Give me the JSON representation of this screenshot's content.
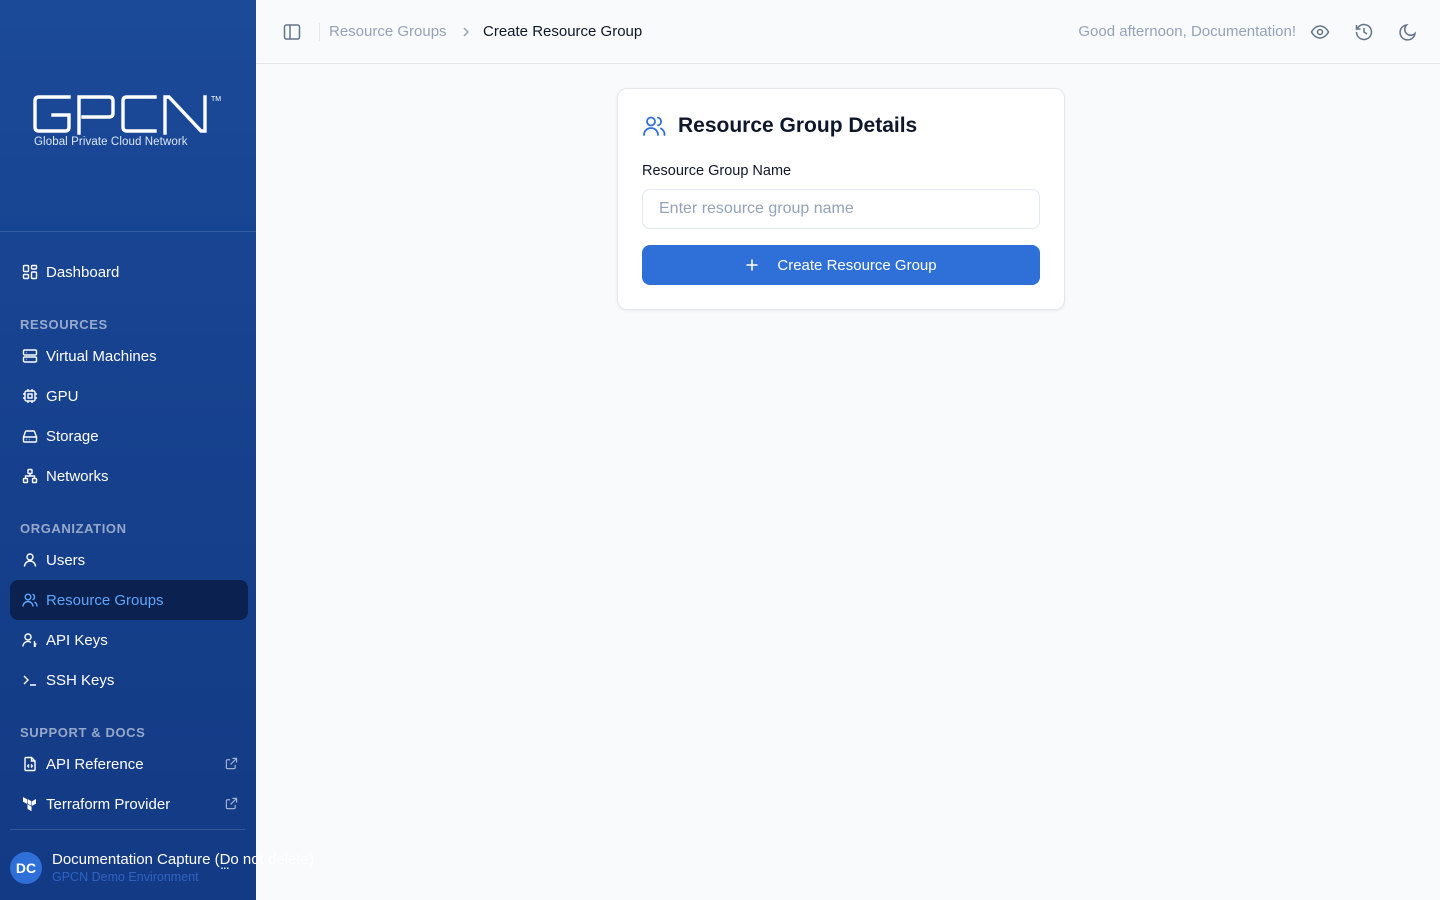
{
  "brand": {
    "logo_text": "GPCN",
    "trademark": "TM",
    "tagline": "Global Private Cloud Network"
  },
  "sidebar": {
    "dashboard": "Dashboard",
    "sections": {
      "resources": "RESOURCES",
      "organization": "ORGANIZATION",
      "support": "SUPPORT & DOCS"
    },
    "resources_items": [
      {
        "label": "Virtual Machines",
        "icon": "server-icon"
      },
      {
        "label": "GPU",
        "icon": "cpu-icon"
      },
      {
        "label": "Storage",
        "icon": "hard-drive-icon"
      },
      {
        "label": "Networks",
        "icon": "network-icon"
      }
    ],
    "organization_items": [
      {
        "label": "Users",
        "icon": "user-icon"
      },
      {
        "label": "Resource Groups",
        "icon": "users-icon",
        "active": true
      },
      {
        "label": "API Keys",
        "icon": "user-key-icon"
      },
      {
        "label": "SSH Keys",
        "icon": "terminal-icon"
      }
    ],
    "support_items": [
      {
        "label": "API Reference",
        "icon": "file-code-icon",
        "external": true
      },
      {
        "label": "Terraform Provider",
        "icon": "terraform-icon",
        "external": true
      }
    ],
    "user": {
      "initials": "DC",
      "name": "Documentation Capture (Do not delete)",
      "environment": "GPCN Demo Environment",
      "more": "..."
    }
  },
  "header": {
    "breadcrumb_parent": "Resource Groups",
    "breadcrumb_current": "Create Resource Group",
    "greeting": "Good afternoon, Documentation!"
  },
  "card": {
    "title": "Resource Group Details",
    "field_label": "Resource Group Name",
    "field_value": "",
    "field_placeholder": "Enter resource group name",
    "submit_label": "Create Resource Group"
  },
  "colors": {
    "sidebar_bg": "#1b4a99",
    "active_bg": "#0b2150",
    "active_text": "#60a5fa",
    "primary": "#2f6fd8"
  }
}
